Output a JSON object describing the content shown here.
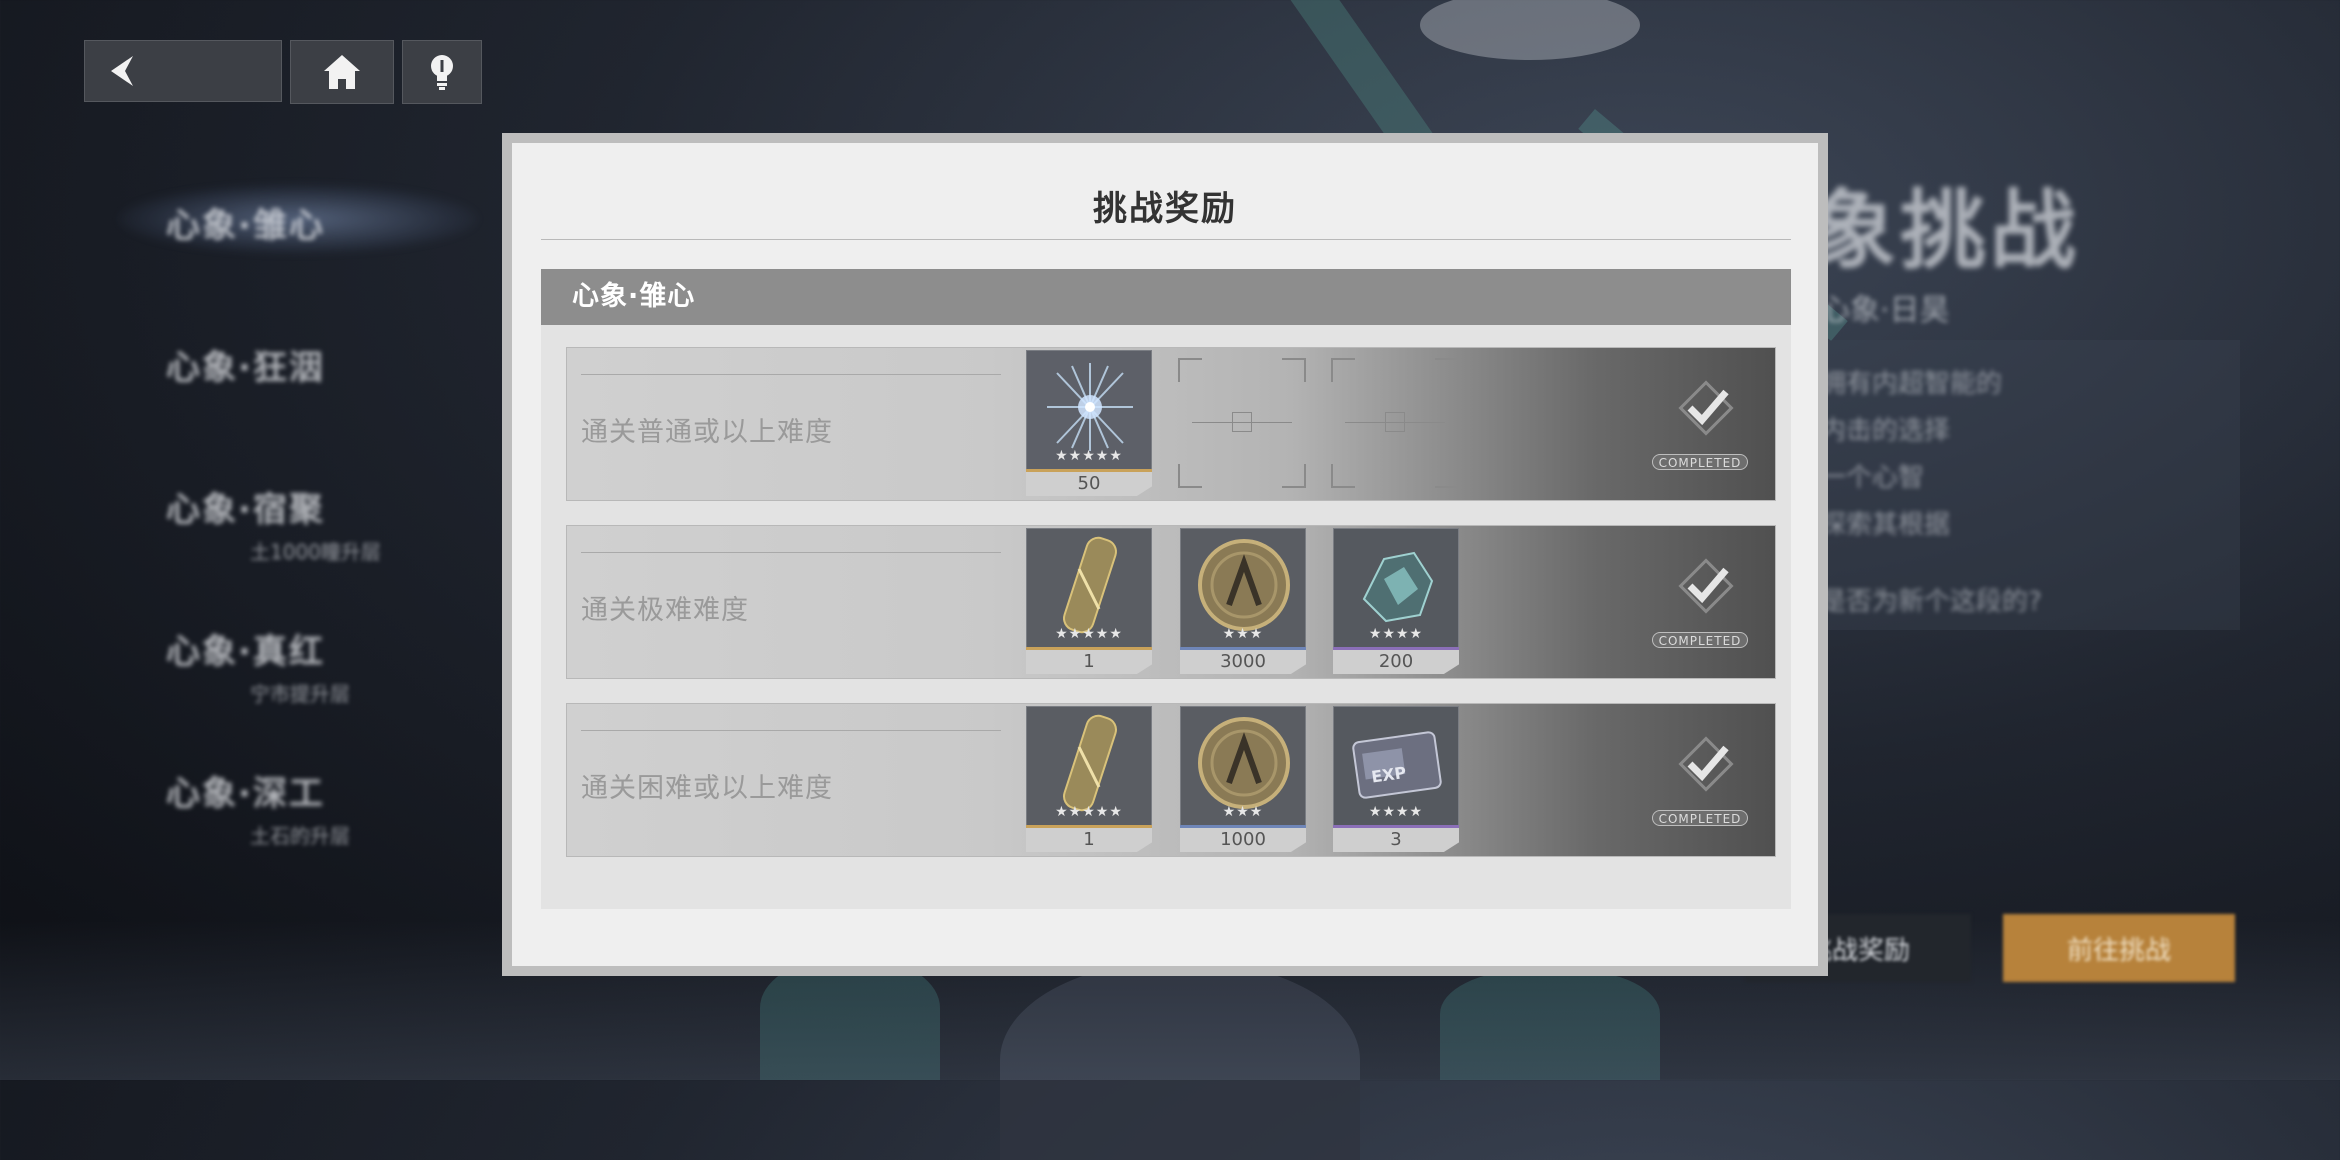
{
  "nav": {
    "back_icon": "back-arrow-icon",
    "home_icon": "home-icon",
    "hint_icon": "lightbulb-icon"
  },
  "side_menu": [
    {
      "label": "心象·雏心",
      "sub": ""
    },
    {
      "label": "心象·狂洇",
      "sub": ""
    },
    {
      "label": "心象·宿聚",
      "sub": "土1000瞳升层"
    },
    {
      "label": "心象·真红",
      "sub": "宁市提升层"
    },
    {
      "label": "心象·深工",
      "sub": "土石的升层"
    }
  ],
  "right_panel": {
    "title": "象挑战",
    "subtitle": "心象·日昊",
    "lines": [
      "拥有内超智能的",
      "内击的选择",
      "一个心智",
      "探索其根据"
    ],
    "question": "是否为新个这段的?",
    "btn_rewards": "挑战奖励",
    "btn_start": "前往挑战"
  },
  "modal": {
    "title": "挑战奖励",
    "section_title": "心象·雏心",
    "rows": [
      {
        "label": "通关普通或以上难度",
        "rewards": [
          {
            "qty": "50",
            "stars": "★★★★★",
            "icon": "crystal-star-icon",
            "rarity_color": "#c9a25a"
          }
        ],
        "empty_slots": 2,
        "status": "COMPLETED"
      },
      {
        "label": "通关极难难度",
        "rewards": [
          {
            "qty": "1",
            "stars": "★★★★★",
            "icon": "gold-capsule-icon",
            "rarity_color": "#c9a25a"
          },
          {
            "qty": "3000",
            "stars": "★★★",
            "icon": "gold-coin-icon",
            "rarity_color": "#6f86b8"
          },
          {
            "qty": "200",
            "stars": "★★★★",
            "icon": "teal-shard-icon",
            "rarity_color": "#8b6fb8"
          }
        ],
        "empty_slots": 0,
        "status": "COMPLETED"
      },
      {
        "label": "通关困难或以上难度",
        "rewards": [
          {
            "qty": "1",
            "stars": "★★★★★",
            "icon": "gold-capsule-icon",
            "rarity_color": "#c9a25a"
          },
          {
            "qty": "1000",
            "stars": "★★★",
            "icon": "gold-coin-icon",
            "rarity_color": "#6f86b8"
          },
          {
            "qty": "3",
            "stars": "★★★★",
            "icon": "exp-chip-icon",
            "rarity_color": "#8b6fb8"
          }
        ],
        "empty_slots": 0,
        "status": "COMPLETED"
      }
    ]
  }
}
